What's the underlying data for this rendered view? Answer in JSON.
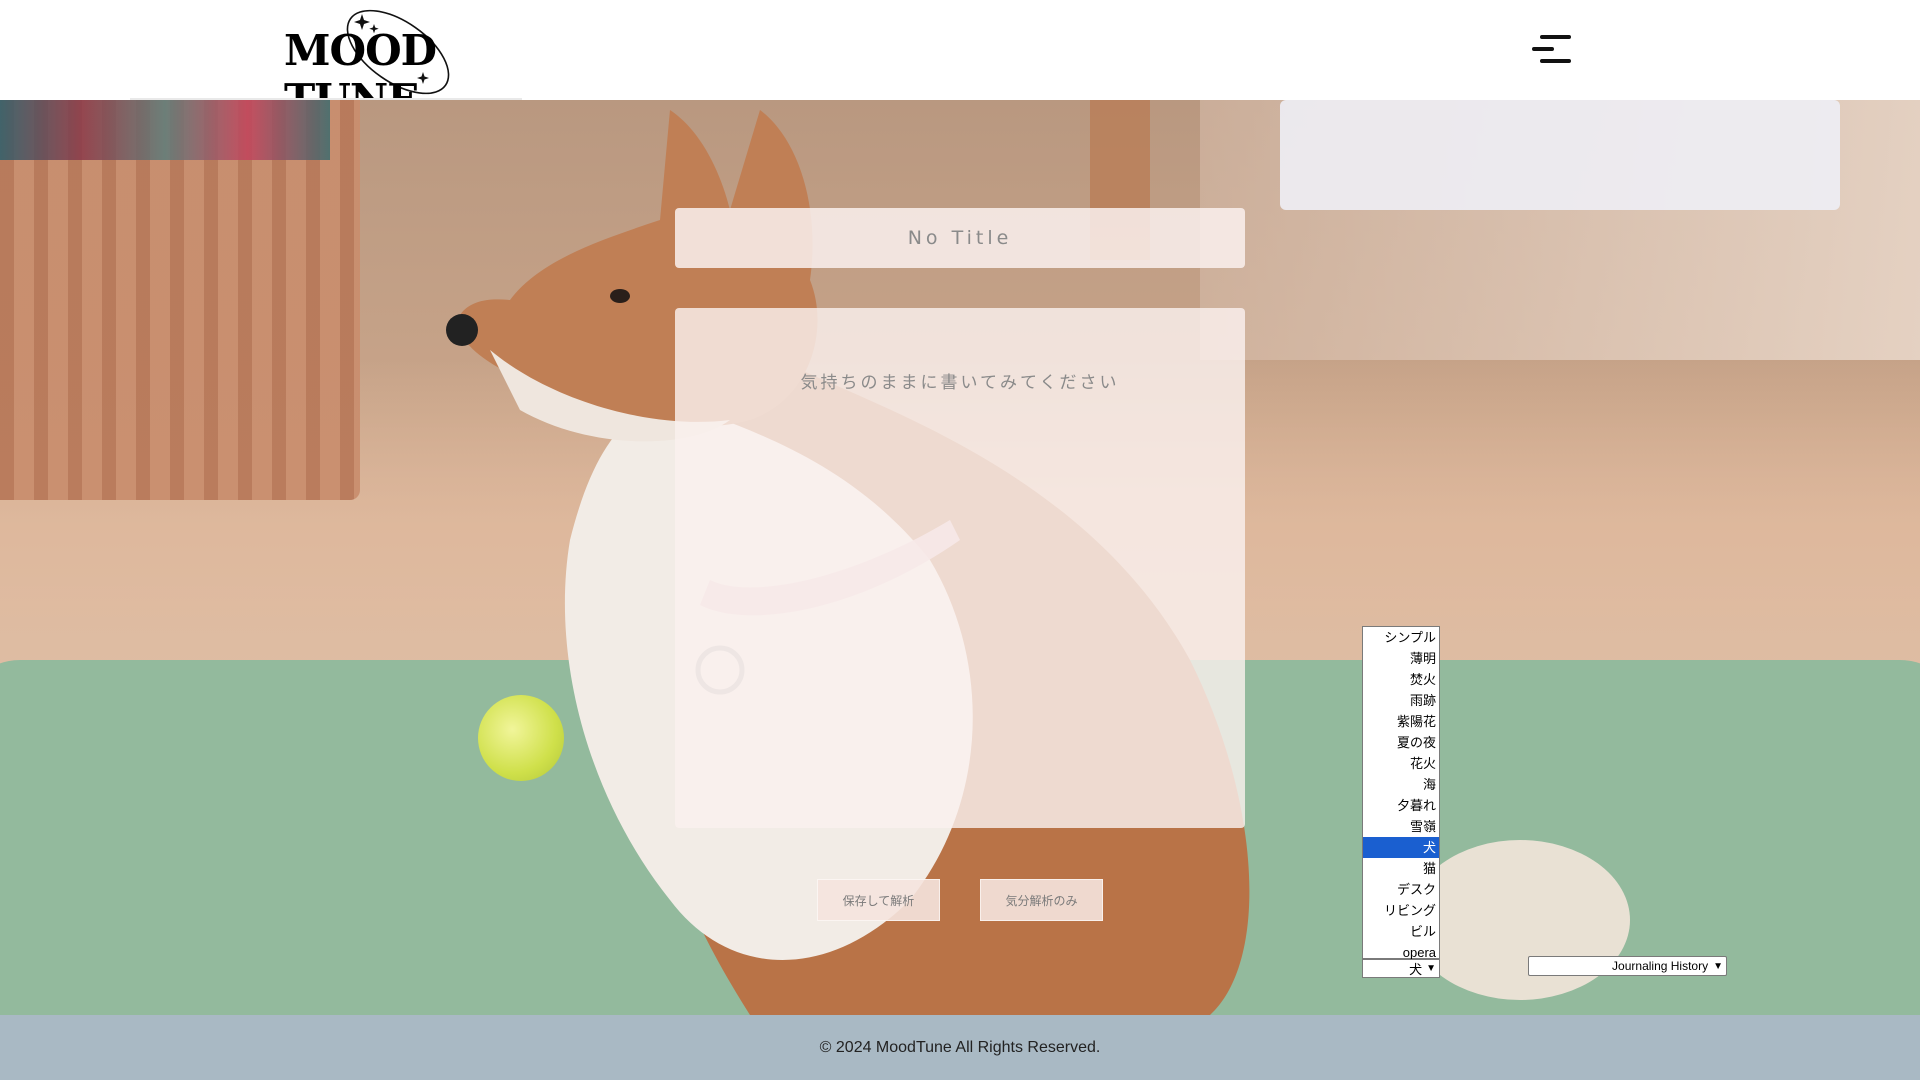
{
  "header": {
    "logo_text": "MOOD TUNE",
    "menu_icon": "hamburger-menu-icon"
  },
  "journal": {
    "title_placeholder": "No Title",
    "body_placeholder": "気持ちのままに書いてみてください",
    "save_button": "保存して解析",
    "analyze_button": "気分解析のみ"
  },
  "theme_select": {
    "options": [
      "シンプル",
      "薄明",
      "焚火",
      "雨跡",
      "紫陽花",
      "夏の夜",
      "花火",
      "海",
      "夕暮れ",
      "雪嶺",
      "犬",
      "猫",
      "デスク",
      "リビング",
      "ビル",
      "opera"
    ],
    "selected": "犬"
  },
  "history_select": {
    "selected": "Journaling History"
  },
  "footer": {
    "copyright": "© 2024 MoodTune All Rights Reserved."
  },
  "colors": {
    "footer_bg": "#a9b9c4",
    "selected_option": "#1a5fd0"
  }
}
